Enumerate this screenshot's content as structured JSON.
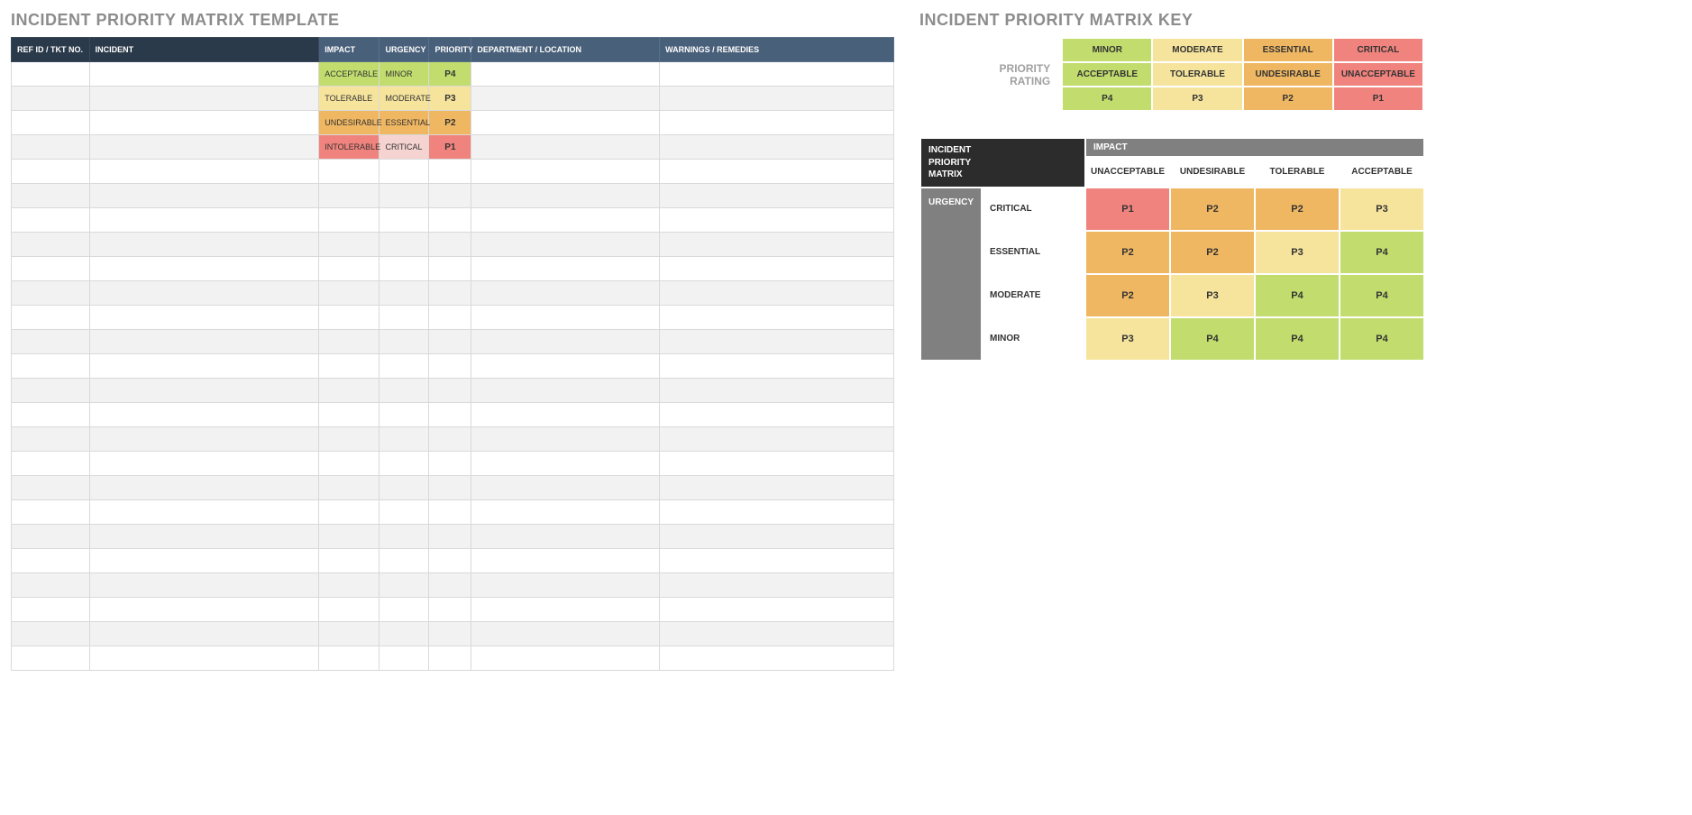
{
  "titles": {
    "template": "INCIDENT PRIORITY MATRIX TEMPLATE",
    "key": "INCIDENT PRIORITY MATRIX KEY"
  },
  "template_table": {
    "headers": {
      "ref": "REF ID / TKT NO.",
      "incident": "INCIDENT",
      "impact": "IMPACT",
      "urgency": "URGENCY",
      "priority": "PRIORITY",
      "department": "DEPARTMENT / LOCATION",
      "warnings": "WARNINGS / REMEDIES"
    },
    "rows": [
      {
        "impact": "ACCEPTABLE",
        "impact_c": "g",
        "urgency": "MINOR",
        "urgency_c": "g",
        "priority": "P4",
        "pri_c": "g"
      },
      {
        "impact": "TOLERABLE",
        "impact_c": "y",
        "urgency": "MODERATE",
        "urgency_c": "y",
        "priority": "P3",
        "pri_c": "y"
      },
      {
        "impact": "UNDESIRABLE",
        "impact_c": "o",
        "urgency": "ESSENTIAL",
        "urgency_c": "o",
        "priority": "P2",
        "pri_c": "o"
      },
      {
        "impact": "INTOLERABLE",
        "impact_c": "r",
        "urgency": "CRITICAL",
        "urgency_c": "p",
        "priority": "P1",
        "pri_c": "r"
      }
    ],
    "empty_row_count": 21
  },
  "priority_key": {
    "label": "PRIORITY RATING",
    "columns": [
      {
        "l1": "MINOR",
        "l2": "ACCEPTABLE",
        "l3": "P4",
        "c": "g"
      },
      {
        "l1": "MODERATE",
        "l2": "TOLERABLE",
        "l3": "P3",
        "c": "y"
      },
      {
        "l1": "ESSENTIAL",
        "l2": "UNDESIRABLE",
        "l3": "P2",
        "c": "o"
      },
      {
        "l1": "CRITICAL",
        "l2": "UNACCEPTABLE",
        "l3": "P1",
        "c": "r"
      }
    ]
  },
  "matrix": {
    "corner": "INCIDENT PRIORITY MATRIX",
    "impact_label": "IMPACT",
    "urgency_label": "URGENCY",
    "impact_cols": [
      "UNACCEPTABLE",
      "UNDESIRABLE",
      "TOLERABLE",
      "ACCEPTABLE"
    ],
    "rows": [
      {
        "label": "CRITICAL",
        "cells": [
          {
            "v": "P1",
            "c": "r"
          },
          {
            "v": "P2",
            "c": "o"
          },
          {
            "v": "P2",
            "c": "o"
          },
          {
            "v": "P3",
            "c": "y"
          }
        ]
      },
      {
        "label": "ESSENTIAL",
        "cells": [
          {
            "v": "P2",
            "c": "o"
          },
          {
            "v": "P2",
            "c": "o"
          },
          {
            "v": "P3",
            "c": "y"
          },
          {
            "v": "P4",
            "c": "g"
          }
        ]
      },
      {
        "label": "MODERATE",
        "cells": [
          {
            "v": "P2",
            "c": "o"
          },
          {
            "v": "P3",
            "c": "y"
          },
          {
            "v": "P4",
            "c": "g"
          },
          {
            "v": "P4",
            "c": "g"
          }
        ]
      },
      {
        "label": "MINOR",
        "cells": [
          {
            "v": "P3",
            "c": "y"
          },
          {
            "v": "P4",
            "c": "g"
          },
          {
            "v": "P4",
            "c": "g"
          },
          {
            "v": "P4",
            "c": "g"
          }
        ]
      }
    ]
  }
}
